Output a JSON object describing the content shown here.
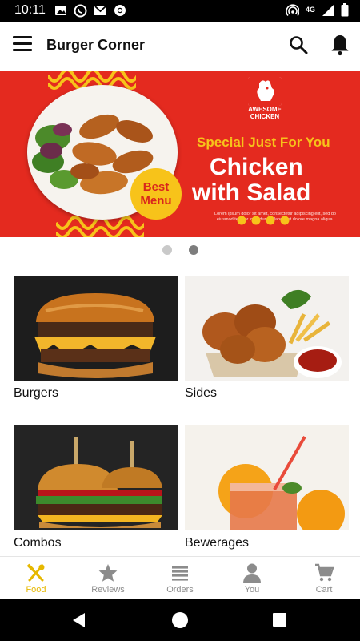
{
  "status_bar": {
    "time": "10:11",
    "left_icons": [
      "gallery-icon",
      "whatsapp-icon",
      "gmail-icon",
      "chrome-icon"
    ],
    "right_icons": [
      "hotspot-icon",
      "network-4g-icon",
      "signal-icon",
      "battery-icon"
    ],
    "network_label": "4G"
  },
  "app_bar": {
    "title": "Burger Corner",
    "menu_icon": "hamburger-menu-icon",
    "search_icon": "search-icon",
    "notification_icon": "bell-icon"
  },
  "banner": {
    "brand": "AWESOME CHICKEN",
    "kicker": "Special Just For You",
    "title_line1": "Chicken",
    "title_line2": "with Salad",
    "badge": "Best Menu",
    "fine_print": "Lorem ipsum dolor sit amet, consectetur adipiscing elit, sed do eiusmod tempor incididunt ut labore et dolore magna aliqua.",
    "colors": {
      "background": "#e42a1f",
      "accent": "#f7c31a",
      "text": "#ffffff"
    }
  },
  "carousel": {
    "page_count": 2,
    "active_index": 1
  },
  "categories": [
    {
      "label": "Burgers"
    },
    {
      "label": "Sides"
    },
    {
      "label": "Combos"
    },
    {
      "label": "Bewerages"
    }
  ],
  "bottom_nav": {
    "items": [
      {
        "label": "Food",
        "icon": "food-utensils-icon",
        "active": true
      },
      {
        "label": "Reviews",
        "icon": "star-icon",
        "active": false
      },
      {
        "label": "Orders",
        "icon": "list-icon",
        "active": false
      },
      {
        "label": "You",
        "icon": "person-icon",
        "active": false
      },
      {
        "label": "Cart",
        "icon": "cart-icon",
        "active": false
      }
    ],
    "active_color": "#e6b800",
    "inactive_color": "#8c8c8c"
  },
  "system_nav": {
    "icons": [
      "back-icon",
      "home-icon",
      "recents-icon"
    ]
  }
}
